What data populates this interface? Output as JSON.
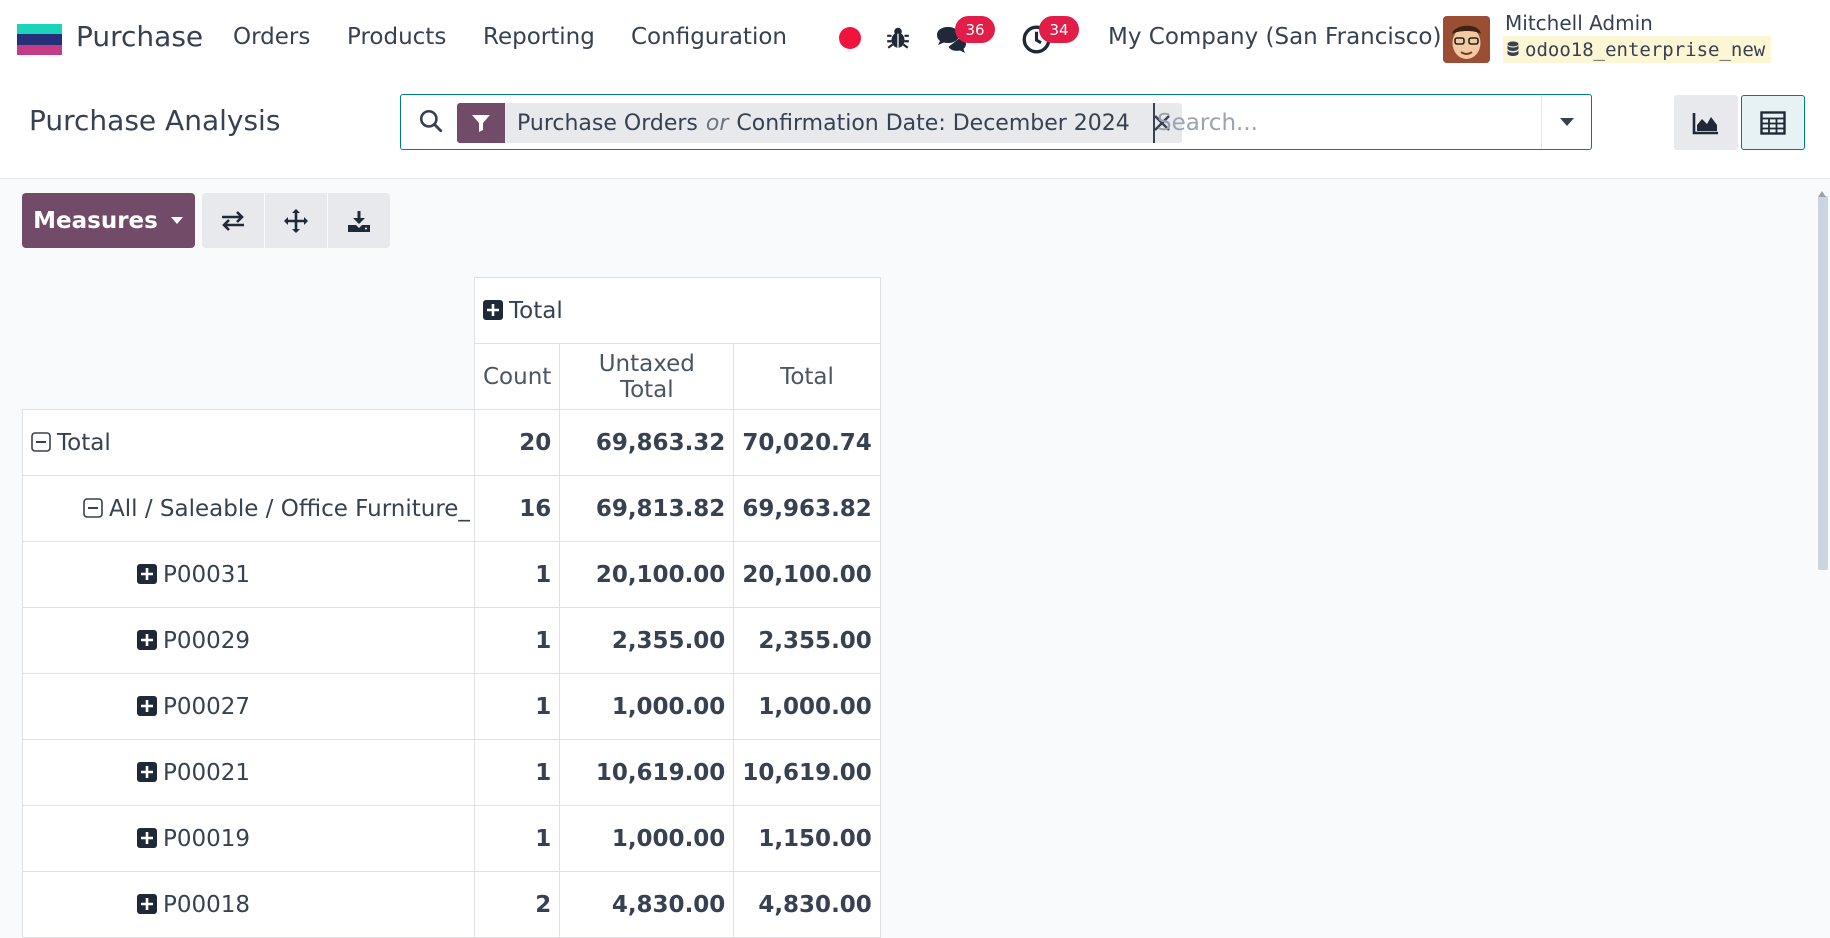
{
  "navbar": {
    "app_name": "Purchase",
    "menus": [
      "Orders",
      "Products",
      "Reporting",
      "Configuration"
    ],
    "messages_count": "36",
    "activities_count": "34",
    "company": "My Company (San Francisco)",
    "user_name": "Mitchell Admin",
    "database": "odoo18_enterprise_new",
    "icons": [
      "record-dot-icon",
      "bug-icon",
      "chat-icon",
      "clock-icon",
      "database-icon"
    ],
    "colors": {
      "record_dot": "#f0133e",
      "badge": "#e11d48",
      "logo_top": "#1ad3bb",
      "logo_mid": "#26307a",
      "logo_bottom": "#c63b86"
    }
  },
  "control": {
    "title": "Purchase Analysis",
    "facet_first": "Purchase Orders",
    "facet_or": "or",
    "facet_second": "Confirmation Date: December 2024",
    "search_placeholder": "Search..."
  },
  "toolbar": {
    "measures_label": "Measures",
    "accent": "#714b67"
  },
  "pivot": {
    "col_header": "Total",
    "measures": [
      "Count",
      "Untaxed Total",
      "Total"
    ],
    "rows": [
      {
        "label": "Total",
        "count": "20",
        "untaxed": "69,863.32",
        "total": "70,020.74"
      },
      {
        "label": "All / Saleable / Office Furniture_",
        "count": "16",
        "untaxed": "69,813.82",
        "total": "69,963.82"
      },
      {
        "label": "P00031",
        "count": "1",
        "untaxed": "20,100.00",
        "total": "20,100.00"
      },
      {
        "label": "P00029",
        "count": "1",
        "untaxed": "2,355.00",
        "total": "2,355.00"
      },
      {
        "label": "P00027",
        "count": "1",
        "untaxed": "1,000.00",
        "total": "1,000.00"
      },
      {
        "label": "P00021",
        "count": "1",
        "untaxed": "10,619.00",
        "total": "10,619.00"
      },
      {
        "label": "P00019",
        "count": "1",
        "untaxed": "1,000.00",
        "total": "1,150.00"
      },
      {
        "label": "P00018",
        "count": "2",
        "untaxed": "4,830.00",
        "total": "4,830.00"
      }
    ]
  }
}
